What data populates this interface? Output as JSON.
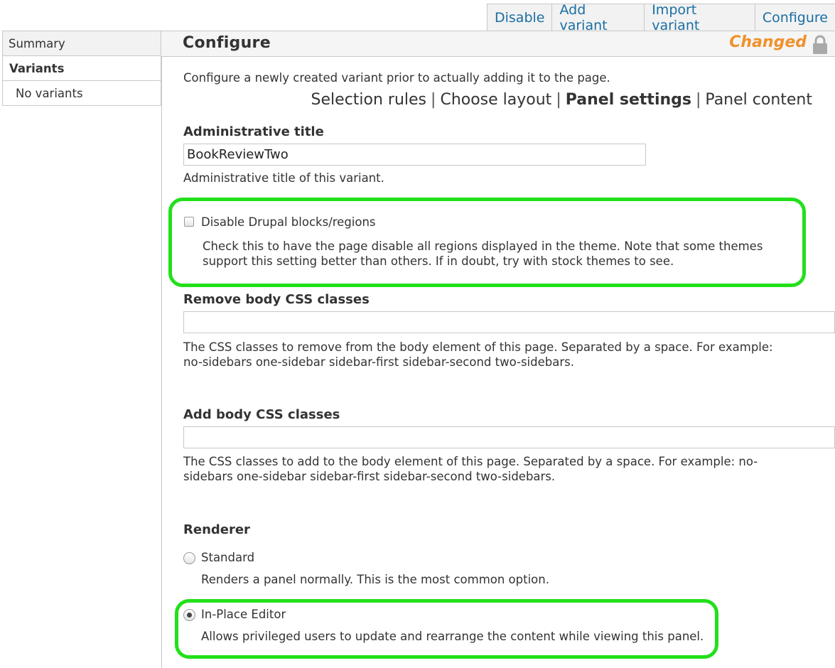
{
  "tabs": [
    "Disable",
    "Add variant",
    "Import variant",
    "Configure"
  ],
  "sidebar": {
    "summary": "Summary",
    "variants": "Variants",
    "no_variants": "No variants"
  },
  "header": {
    "title": "Configure",
    "status": "Changed",
    "lock_icon": "lock-icon"
  },
  "intro": "Configure a newly created variant prior to actually adding it to the page.",
  "steps": [
    "Selection rules",
    "Choose layout",
    "Panel settings",
    "Panel content"
  ],
  "admin_title": {
    "label": "Administrative title",
    "value": "BookReviewTwo",
    "description": "Administrative title of this variant."
  },
  "disable_blocks": {
    "label": "Disable Drupal blocks/regions",
    "checked": false,
    "description_line1": "Check this to have the page disable all regions displayed in the theme. Note that some themes",
    "description_line2": "support this setting better than others. If in doubt, try with stock themes to see."
  },
  "remove_css": {
    "label": "Remove body CSS classes",
    "value": "",
    "description_line1": "The CSS classes to remove from the body element of this page. Separated by a space. For example:",
    "description_line2": "no-sidebars one-sidebar sidebar-first sidebar-second two-sidebars."
  },
  "add_css": {
    "label": "Add body CSS classes",
    "value": "",
    "description_line1": "The CSS classes to add to the body element of this page. Separated by a space. For example: no-",
    "description_line2": "sidebars one-sidebar sidebar-first sidebar-second two-sidebars."
  },
  "renderer": {
    "label": "Renderer",
    "options": [
      {
        "label": "Standard",
        "description": "Renders a panel normally. This is the most common option.",
        "selected": false
      },
      {
        "label": "In-Place Editor",
        "description": "Allows privileged users to update and rearrange the content while viewing this panel.",
        "selected": true
      }
    ]
  },
  "colors": {
    "link": "#1a6ea3",
    "changed": "#f0912b",
    "highlight": "#22e01a"
  }
}
